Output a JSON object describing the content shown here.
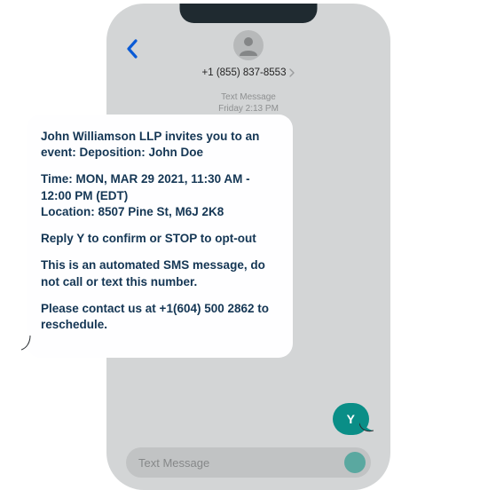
{
  "header": {
    "phone_number": "+1 (855) 837-8553"
  },
  "meta": {
    "line1": "Text Message",
    "line2": "Friday 2:13 PM"
  },
  "incoming": {
    "p1": "John Williamson LLP invites you to an event: Deposition: John Doe",
    "p2": "Time: MON, MAR 29 2021, 11:30 AM - 12:00 PM (EDT)\nLocation: 8507 Pine St, M6J 2K8",
    "p3": "Reply Y to confirm or STOP to opt-out",
    "p4": "This is an automated SMS message, do not call or text this number.",
    "p5": "Please contact us at +1(604) 500 2862 to reschedule."
  },
  "outgoing": {
    "text": "Y"
  },
  "composer": {
    "placeholder": "Text Message"
  }
}
